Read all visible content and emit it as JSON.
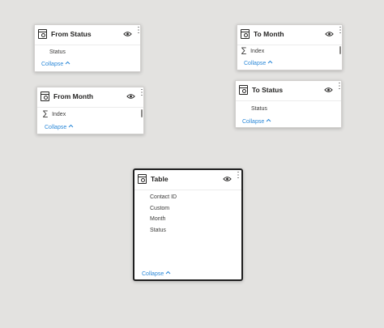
{
  "cards": {
    "from_status": {
      "title": "From Status",
      "fields": [
        "Status"
      ],
      "collapse": "Collapse"
    },
    "from_month": {
      "title": "From Month",
      "fields": [
        "Index"
      ],
      "sigma": "∑",
      "collapse": "Collapse"
    },
    "to_month": {
      "title": "To Month",
      "fields": [
        "Index"
      ],
      "sigma": "∑",
      "collapse": "Collapse"
    },
    "to_status": {
      "title": "To Status",
      "fields": [
        "Status"
      ],
      "collapse": "Collapse"
    },
    "table": {
      "title": "Table",
      "fields": [
        "Contact ID",
        "Custom",
        "Month",
        "Status"
      ],
      "collapse": "Collapse"
    }
  },
  "icons": {
    "header": "table-icon",
    "visibility": "eye-icon",
    "menu": "more-options-icon",
    "chevron": "chevron-up-icon",
    "sum": "sigma-icon"
  },
  "colors": {
    "background": "#e3e2e0",
    "link": "#2b88d8",
    "selected_border": "#1f1f1f"
  }
}
